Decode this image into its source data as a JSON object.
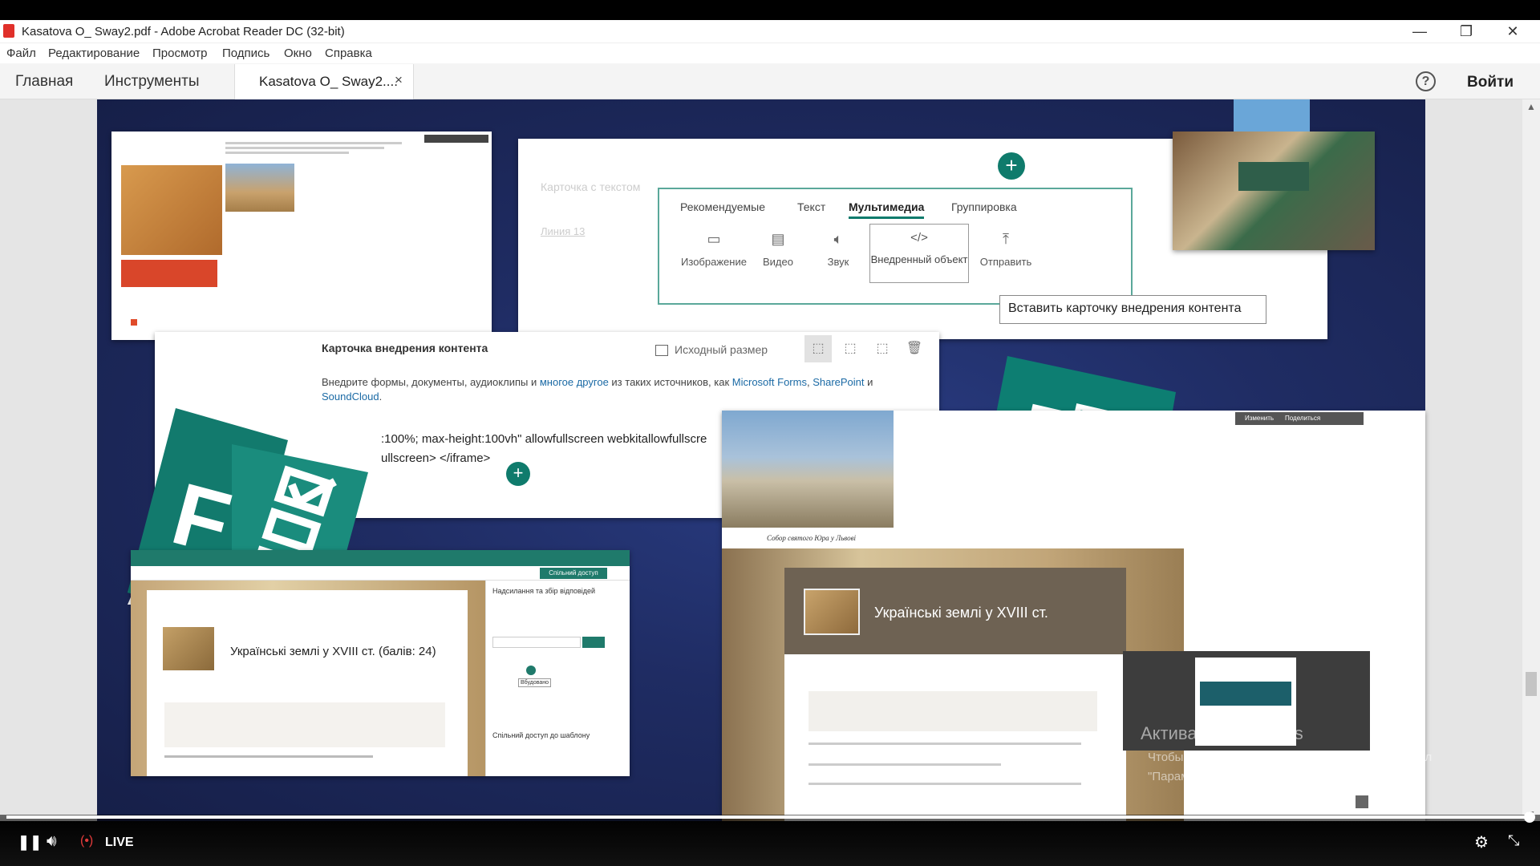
{
  "window": {
    "title": "Kasatova O_ Sway2.pdf - Adobe Acrobat Reader DC (32-bit)",
    "minimize": "—",
    "restore": "❐",
    "close": "✕"
  },
  "menu": [
    "Файл",
    "Редактирование",
    "Просмотр",
    "Подпись",
    "Окно",
    "Справка"
  ],
  "tabs": {
    "home": "Главная",
    "tools": "Инструменты",
    "document": "Kasatova O_ Sway2....",
    "close": "×",
    "help": "?",
    "login": "Войти"
  },
  "sway_panel": {
    "blurred_card_title": "Карточка с текстом",
    "blurred_card_sub": "Линия 13",
    "tabs": [
      "Рекомендуемые",
      "Текст",
      "Мультимедиа",
      "Группировка"
    ],
    "active_tab": "Мультимедиа",
    "items": [
      "Изображение",
      "Видео",
      "Звук",
      "Внедренный объект",
      "Отправить"
    ],
    "tooltip": "Вставить карточку внедрения контента",
    "plus": "+"
  },
  "embed_card": {
    "title": "Карточка внедрения контента",
    "original_size": "Исходный размер",
    "desc_prefix": "Внедрите формы, документы, аудиоклипы и ",
    "desc_link": "многое другое",
    "desc_mid": " из таких источников, как ",
    "desc_link2": "Microsoft Forms",
    "desc_sep": ", ",
    "desc_link3": "SharePoint",
    "desc_and": " и ",
    "desc_link4": "SoundCloud",
    "desc_end": ".",
    "code_line1": ":100%; max-height:100vh\" allowfullscreen webkitallowfullscre",
    "code_line2": "ullscreen> </iframe>",
    "plus": "+"
  },
  "forms_card": {
    "heading": "Українські землі у  XVIII ст.",
    "score": "(балів: 24)",
    "side_title": "Надсилання та збір відповідей",
    "share_title": "Спільний доступ до шаблону",
    "share_button": "Спільний доступ",
    "embed_label": "Вбудовано"
  },
  "sway_card": {
    "heading": "Українські землі у  XVIII ст.",
    "photo_caption": "Собор святого Юра у Львові",
    "toolbar": [
      "Изменить",
      "Поделиться"
    ]
  },
  "watermark": {
    "title": "Активация Windows",
    "line1": "Чтобы активировать Windows, перейдите в раздел",
    "line2": "\"Параметры\"."
  },
  "player": {
    "live": "LIVE",
    "progress_percent": 100
  },
  "colors": {
    "accent_green": "#0f7b6c",
    "forms_green": "#127a6d",
    "sharepoint_green": "#0d7e72",
    "slide_bg": "#1f2c63",
    "link_blue": "#1b6aa5"
  },
  "icons": [
    "pdf-icon",
    "help-icon",
    "image-icon",
    "video-icon",
    "sound-icon",
    "embed-code-icon",
    "upload-icon",
    "original-size-icon",
    "fit-icon",
    "fill-icon",
    "crop-icon",
    "trash-icon",
    "plus-icon",
    "forms-logo-icon",
    "sharepoint-logo-icon",
    "pause-icon",
    "volume-icon",
    "live-dot-icon",
    "settings-icon",
    "exit-fullscreen-icon"
  ]
}
